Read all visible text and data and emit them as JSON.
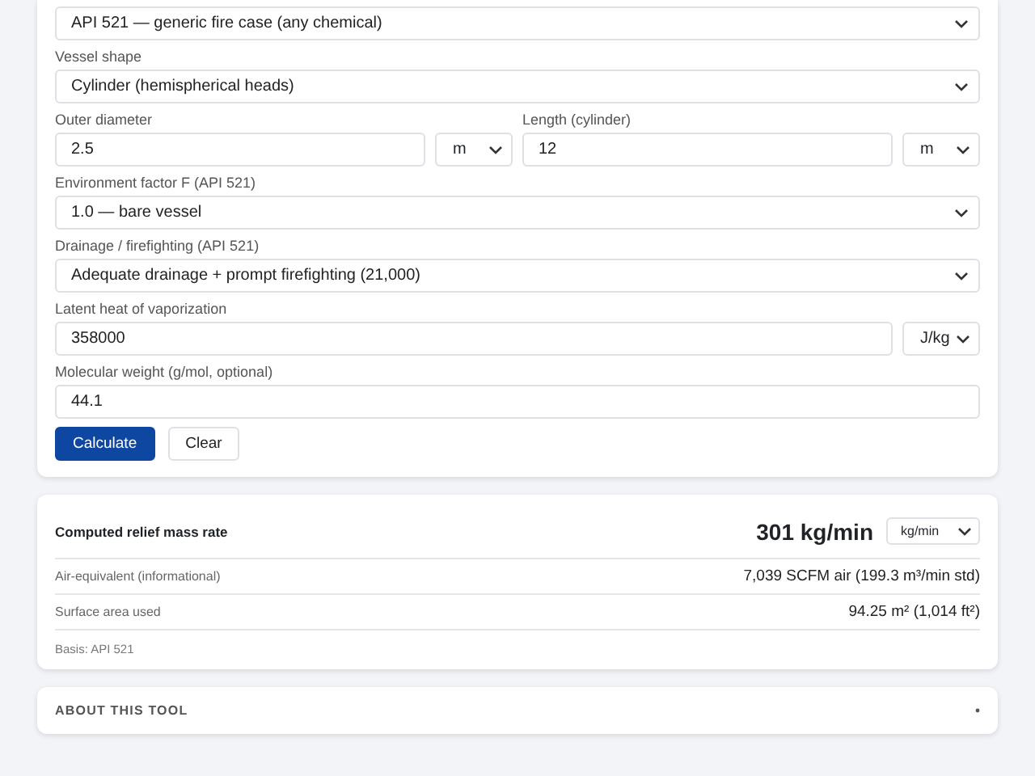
{
  "form": {
    "rows": [
      {
        "fields": [
          {
            "kind": "select",
            "value": "API 521 — generic fire case (any chemical)"
          }
        ]
      },
      {
        "fields": [
          {
            "kind": "select",
            "label": "Vessel shape",
            "value": "Cylinder (hemispherical heads)"
          }
        ]
      },
      {
        "fields": [
          {
            "kind": "input",
            "label": "Outer diameter",
            "value": "2.5",
            "unit": "m"
          },
          {
            "kind": "input",
            "label": "Length (cylinder)",
            "value": "12",
            "unit": "m"
          }
        ]
      },
      {
        "fields": [
          {
            "kind": "select",
            "label": "Environment factor F (API 521)",
            "value": "1.0 — bare vessel"
          }
        ]
      },
      {
        "fields": [
          {
            "kind": "select",
            "label": "Drainage / firefighting (API 521)",
            "value": "Adequate drainage + prompt firefighting (21,000)"
          }
        ]
      },
      {
        "fields": [
          {
            "kind": "input",
            "label": "Latent heat of vaporization",
            "value": "358000",
            "unit": "J/kg"
          }
        ]
      },
      {
        "fields": [
          {
            "kind": "input",
            "label": "Molecular weight (g/mol, optional)",
            "value": "44.1"
          }
        ]
      }
    ],
    "buttons": [
      {
        "label": "Calculate",
        "kind": "primary"
      },
      {
        "label": "Clear",
        "kind": "secondary"
      }
    ]
  },
  "result": {
    "title": "Computed relief mass rate",
    "value": "301 kg/min",
    "unit": "kg/min",
    "rows": [
      {
        "label": "Air-equivalent (informational)",
        "value": "7,039 SCFM air (199.3 m³/min std)"
      },
      {
        "label": "Surface area used",
        "value": "94.25 m² (1,014 ft²)"
      }
    ],
    "basis": "Basis: API 521"
  },
  "about": {
    "title": "ABOUT THIS TOOL"
  }
}
